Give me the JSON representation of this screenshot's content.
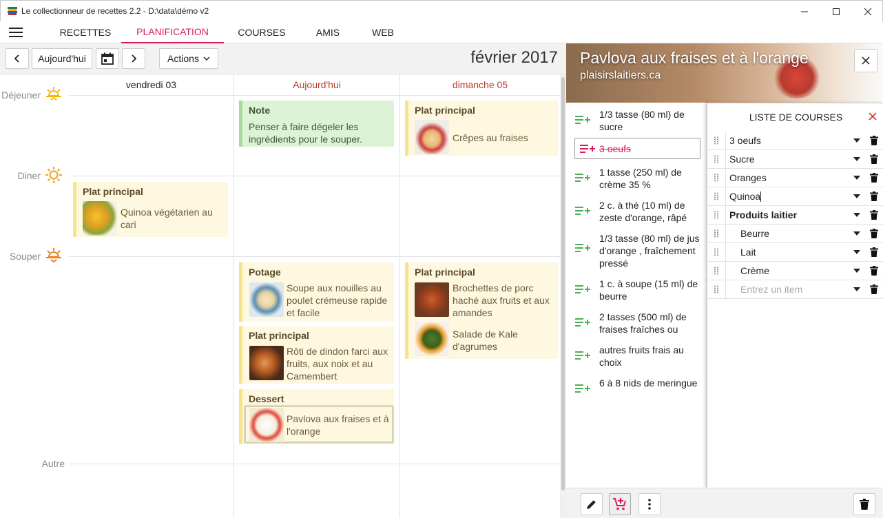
{
  "window": {
    "title": "Le collectionneur de recettes 2.2 - D:\\data\\démo v2"
  },
  "nav": {
    "tabs": [
      {
        "label": "RECETTES"
      },
      {
        "label": "PLANIFICATION"
      },
      {
        "label": "COURSES"
      },
      {
        "label": "AMIS"
      },
      {
        "label": "WEB"
      }
    ],
    "active": "PLANIFICATION"
  },
  "toolbar": {
    "today_label": "Aujourd'hui",
    "actions_label": "Actions",
    "month": "février 2017"
  },
  "calendar": {
    "columns": [
      {
        "label": "vendredi 03"
      },
      {
        "label": "Aujourd'hui"
      },
      {
        "label": "dimanche 05"
      }
    ],
    "meals": [
      {
        "label": "Déjeuner"
      },
      {
        "label": "Diner"
      },
      {
        "label": "Souper"
      },
      {
        "label": "Autre"
      }
    ],
    "cards": {
      "fri_diner": {
        "title": "Plat principal",
        "recipe": "Quinoa végétarien au cari"
      },
      "today_dejeuner": {
        "title": "Note",
        "text": "Penser à faire dégeler les ingrédients pour le souper."
      },
      "today_souper_1": {
        "title": "Potage",
        "recipe": "Soupe aux nouilles au poulet crémeuse rapide et facile"
      },
      "today_souper_2": {
        "title": "Plat principal",
        "recipe": "Rôti de dindon farci aux fruits, aux noix et au Camembert"
      },
      "today_souper_3": {
        "title": "Dessert",
        "recipe": "Pavlova aux fraises et à l'orange"
      },
      "sun_dejeuner": {
        "title": "Plat principal",
        "recipe": "Crêpes au fraises"
      },
      "sun_souper": {
        "title": "Plat principal",
        "recipe_1": "Brochettes de porc haché aux fruits et aux amandes",
        "recipe_2": "Salade de Kale d'agrumes"
      }
    }
  },
  "recipe": {
    "title": "Pavlova aux fraises et à l'orange",
    "source": "plaisirslaitiers.ca",
    "ingredients": [
      {
        "text": "1/3 tasse (80 ml) de sucre"
      },
      {
        "text": "3 oeufs"
      },
      {
        "text": "1 tasse (250 ml) de crème 35 %"
      },
      {
        "text": "2 c. à thé (10 ml) de zeste d'orange, râpé"
      },
      {
        "text": "1/3 tasse (80 ml) de jus d'orange , fraîchement pressé"
      },
      {
        "text": "1 c. à soupe (15 ml) de beurre"
      },
      {
        "text": "2 tasses (500 ml) de fraises fraîches ou"
      },
      {
        "text": "autres fruits frais au choix"
      },
      {
        "text": "6 à 8 nids de meringue"
      }
    ]
  },
  "shopping": {
    "title": "LISTE DE COURSES",
    "items": [
      {
        "label": "3 oeufs"
      },
      {
        "label": "Sucre"
      },
      {
        "label": "Oranges"
      },
      {
        "label": "Quinoa"
      },
      {
        "label": "Produits laitier"
      },
      {
        "label": "Beurre"
      },
      {
        "label": "Lait"
      },
      {
        "label": "Crème"
      }
    ],
    "new_item_placeholder": "Entrez un item"
  },
  "colors": {
    "accent": "#d81b60",
    "add_icon": "#4caf50",
    "card": "#fff8e1",
    "note": "#dcf3d6"
  }
}
